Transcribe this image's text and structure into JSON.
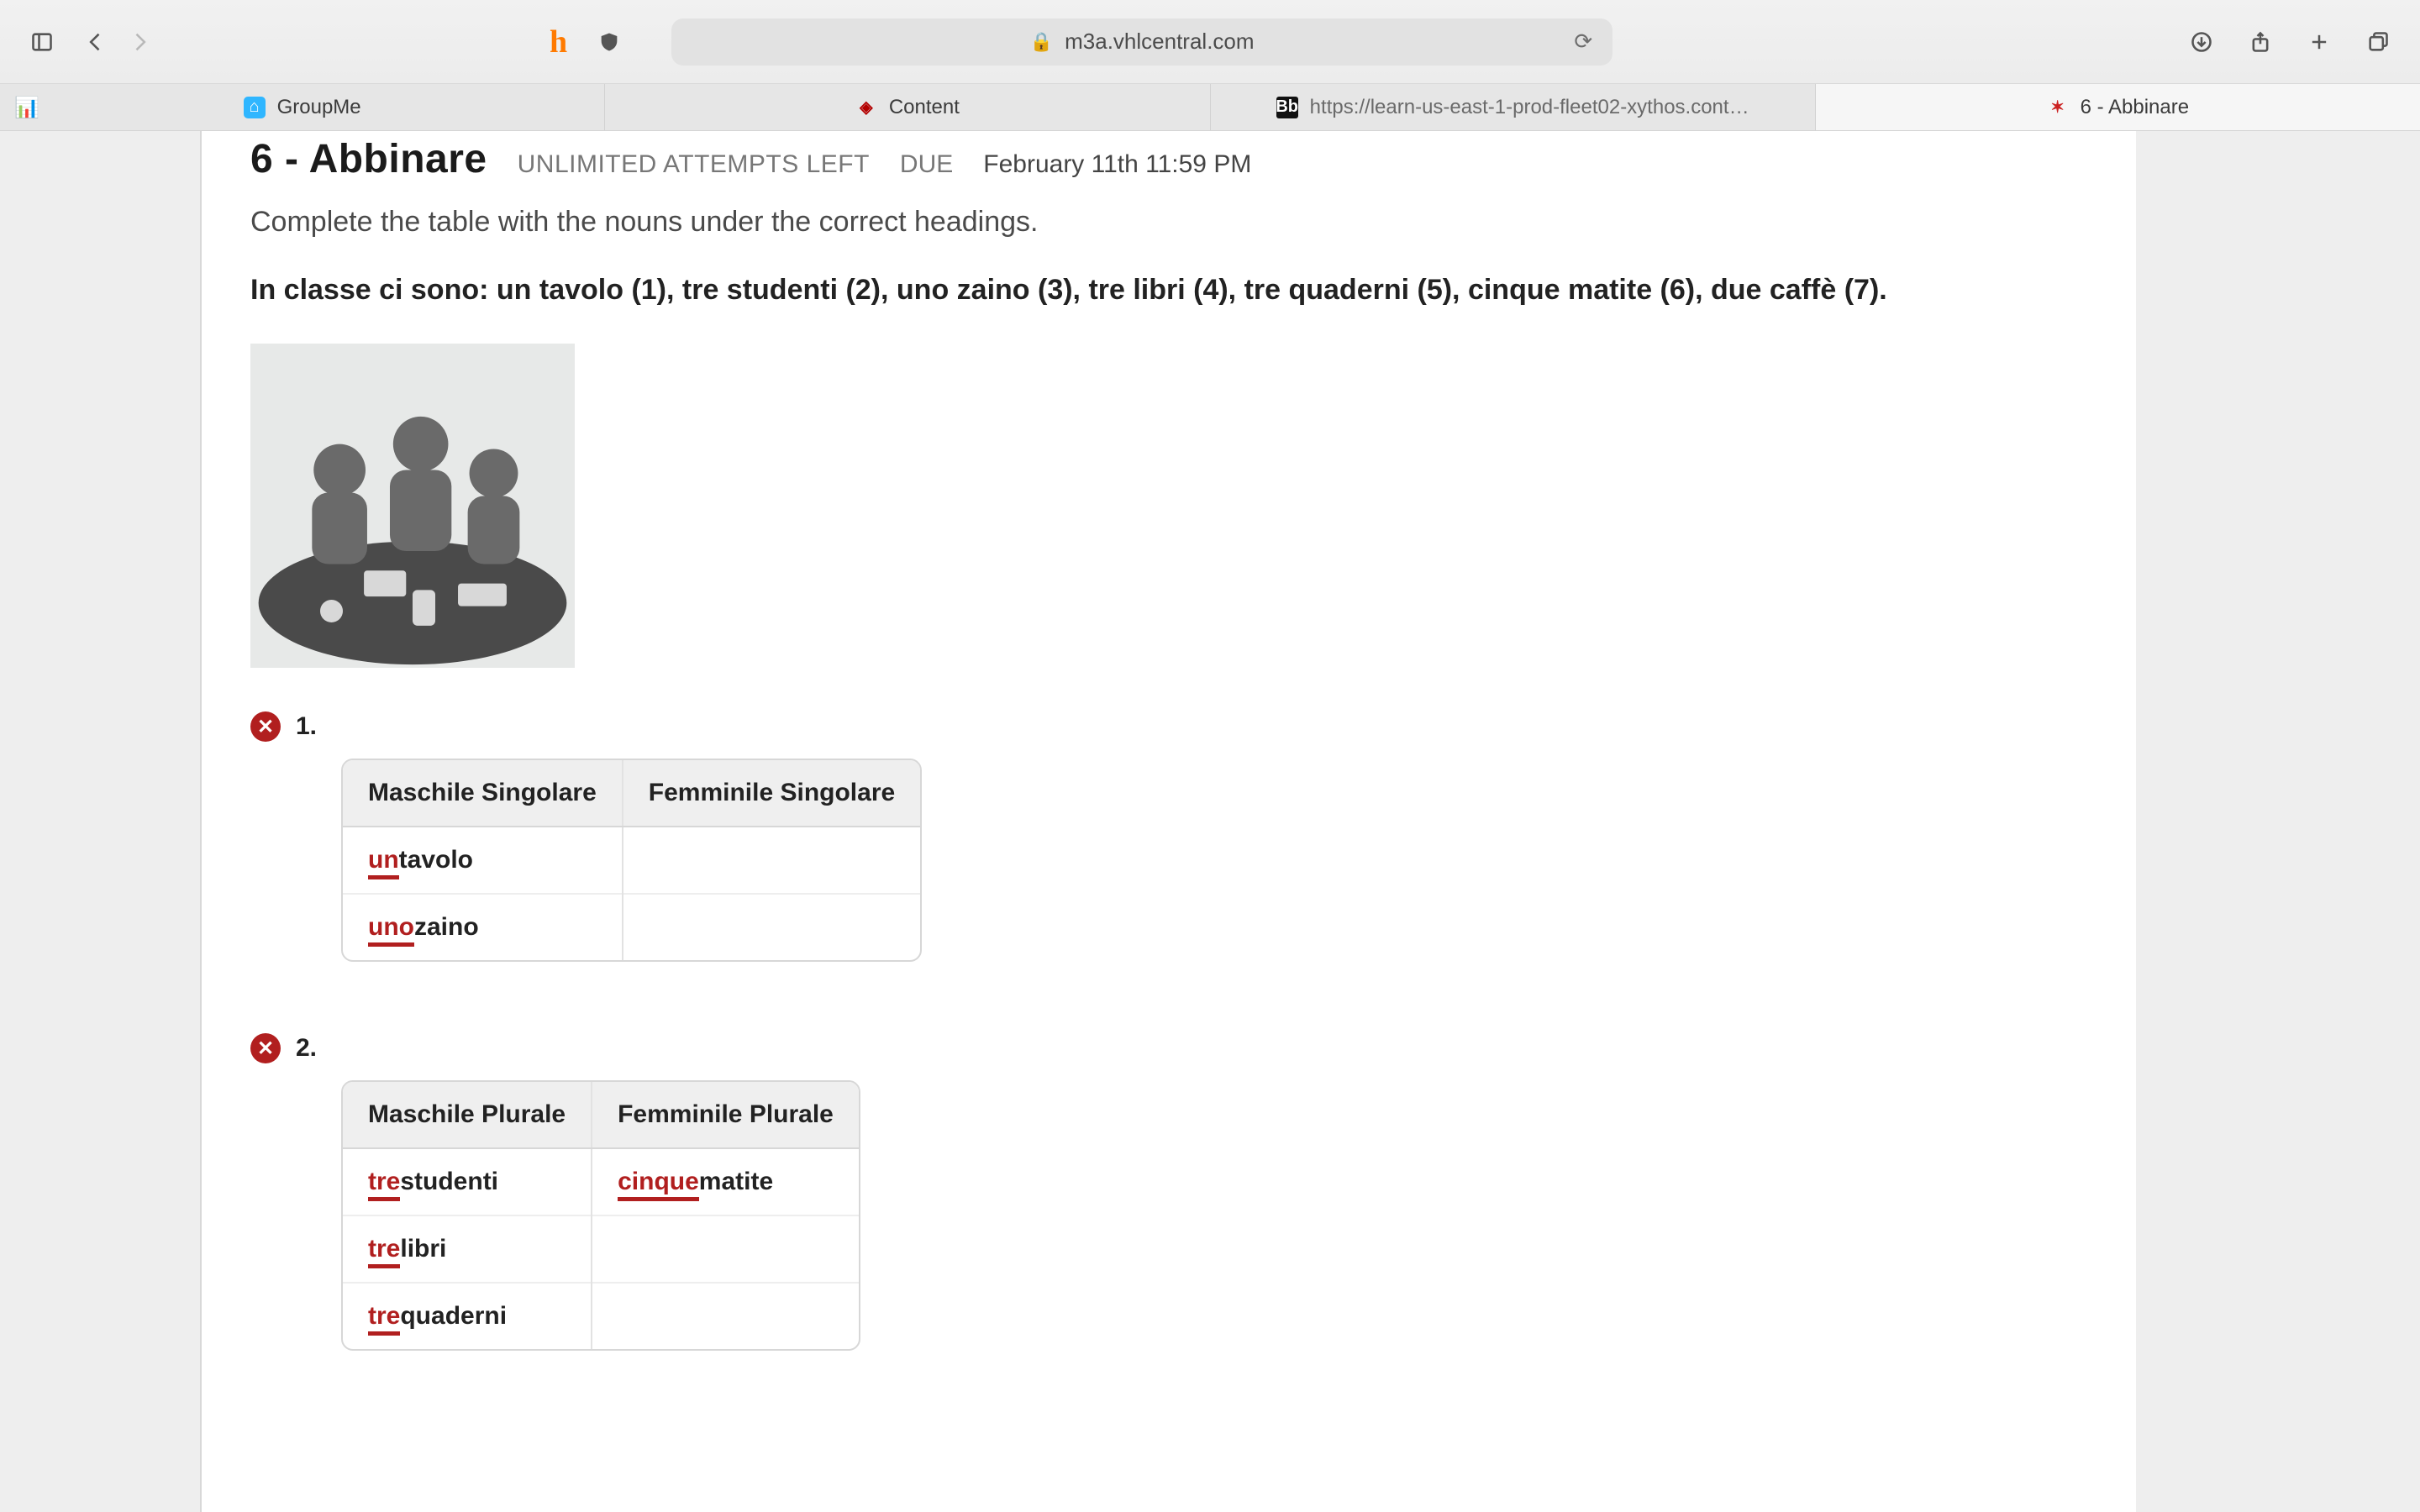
{
  "browser": {
    "url": "m3a.vhlcentral.com",
    "tabs": [
      {
        "icon": "groupme",
        "label": "GroupMe"
      },
      {
        "icon": "content",
        "label": "Content"
      },
      {
        "icon": "bb",
        "label": "https://learn-us-east-1-prod-fleet02-xythos.cont…"
      },
      {
        "icon": "vhl",
        "label": "6 - Abbinare"
      }
    ]
  },
  "assignment": {
    "title": "6 - Abbinare",
    "attempts": "UNLIMITED ATTEMPTS LEFT",
    "due_label": "DUE",
    "due_value": "February 11th 11:59 PM",
    "instructions": "Complete the table with the nouns under the correct headings.",
    "prompt": "In classe ci sono: un tavolo (1), tre studenti (2), uno zaino (3), tre libri (4), tre quaderni (5), cinque matite (6), due caffè (7)."
  },
  "questions": [
    {
      "status": "incorrect",
      "number": "1.",
      "headers": [
        "Maschile Singolare",
        "Femminile Singolare"
      ],
      "rows": [
        [
          {
            "prefix": "un",
            "rest": "tavolo"
          },
          {
            "prefix": "",
            "rest": ""
          }
        ],
        [
          {
            "prefix": "uno",
            "rest": "zaino"
          },
          {
            "prefix": "",
            "rest": ""
          }
        ]
      ]
    },
    {
      "status": "incorrect",
      "number": "2.",
      "headers": [
        "Maschile Plurale",
        "Femminile Plurale"
      ],
      "rows": [
        [
          {
            "prefix": "tre",
            "rest": "studenti"
          },
          {
            "prefix": "cinque",
            "rest": "matite"
          }
        ],
        [
          {
            "prefix": "tre",
            "rest": "libri"
          },
          {
            "prefix": "",
            "rest": ""
          }
        ],
        [
          {
            "prefix": "tre",
            "rest": "quaderni"
          },
          {
            "prefix": "",
            "rest": ""
          }
        ]
      ]
    }
  ]
}
